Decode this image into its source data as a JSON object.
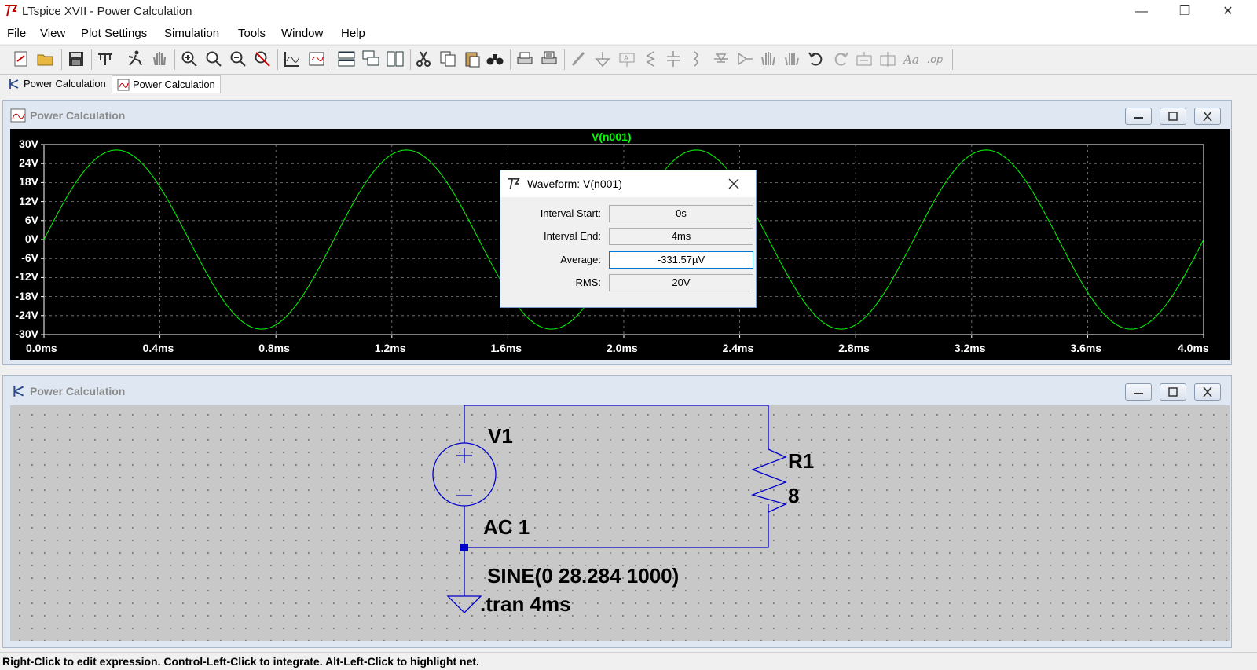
{
  "app": {
    "title": "LTspice XVII - Power Calculation",
    "window_controls": {
      "minimize": "—",
      "restore": "❐",
      "close": "✕"
    }
  },
  "menu": [
    "File",
    "View",
    "Plot Settings",
    "Simulation",
    "Tools",
    "Window",
    "Help"
  ],
  "toolbar": [
    "new-schematic-icon",
    "open-icon",
    "save-icon",
    "control-panel-icon",
    "run-icon",
    "halt-icon",
    "zoom-in-icon",
    "zoom-area-icon",
    "zoom-out-icon",
    "zoom-cancel-icon",
    "autorange-icon",
    "plot-settings-icon",
    "tile-horizontal-icon",
    "cascade-icon",
    "tile-vertical-icon",
    "cut-icon",
    "copy-icon",
    "paste-icon",
    "find-icon",
    "print-icon",
    "print-setup-icon",
    "draw-wire-icon",
    "ground-icon",
    "label-net-icon",
    "resistor-icon",
    "capacitor-icon",
    "inductor-icon",
    "diode-icon",
    "component-icon",
    "move-icon",
    "drag-icon",
    "undo-icon",
    "redo-icon",
    "rotate-icon",
    "mirror-icon",
    "text-icon",
    "spice-directive-icon"
  ],
  "tabs": [
    {
      "label": "Power Calculation",
      "icon": "schematic-icon",
      "active": false
    },
    {
      "label": "Power Calculation",
      "icon": "waveform-icon",
      "active": true
    }
  ],
  "plot_window": {
    "title": "Power Calculation",
    "trace_label": "V(n001)",
    "trace_color": "#00ff00"
  },
  "chart_data": {
    "type": "line",
    "title": "V(n001)",
    "series": [
      {
        "name": "V(n001)",
        "function": "28.284*sin(2*pi*1000*t)",
        "amplitude": 28.284,
        "frequency_hz": 1000
      }
    ],
    "x_ticks": [
      "0.0ms",
      "0.4ms",
      "0.8ms",
      "1.2ms",
      "1.6ms",
      "2.0ms",
      "2.4ms",
      "2.8ms",
      "3.2ms",
      "3.6ms",
      "4.0ms"
    ],
    "y_ticks": [
      "30V",
      "24V",
      "18V",
      "12V",
      "6V",
      "0V",
      "-6V",
      "-12V",
      "-18V",
      "-24V",
      "-30V"
    ],
    "xlim": [
      0,
      4
    ],
    "ylim": [
      -30,
      30
    ],
    "grid": true
  },
  "dialog": {
    "title": "Waveform: V(n001)",
    "fields": [
      {
        "label": "Interval Start:",
        "value": "0s"
      },
      {
        "label": "Interval End:",
        "value": "4ms"
      },
      {
        "label": "Average:",
        "value": "-331.57µV"
      },
      {
        "label": "RMS:",
        "value": "20V"
      }
    ]
  },
  "schematic_window": {
    "title": "Power Calculation",
    "labels": {
      "v1_name": "V1",
      "v1_value": "AC 1",
      "r1_name": "R1",
      "r1_value": "8",
      "sine": "SINE(0 28.284 1000)",
      "tran": ".tran 4ms"
    },
    "wire_color": "#0000cc"
  },
  "status": "Right-Click to edit expression. Control-Left-Click to integrate. Alt-Left-Click to highlight net."
}
